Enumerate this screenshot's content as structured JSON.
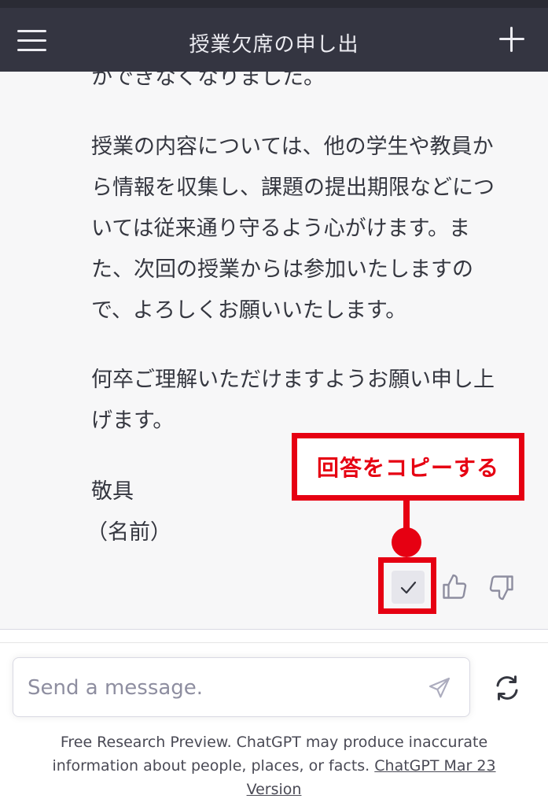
{
  "header": {
    "title": "授業欠席の申し出",
    "menu_icon": "hamburger-menu-icon",
    "new_chat_icon": "plus-icon"
  },
  "message": {
    "partial_line": "かできなくなりました。",
    "paragraphs": [
      [
        "授業の内容については、他の学生や教員か",
        "ら情報を収集し、課題の提出期限などにつ",
        "いては従来通り守るよう心がけます。ま",
        "た、次回の授業からは参加いたしますの",
        "で、よろしくお願いいたします。"
      ],
      [
        "何卒ご理解いただけますようお願い申し上",
        "げます。"
      ]
    ],
    "closing": "敬具",
    "signature": "（名前）"
  },
  "actions": {
    "copy_icon": "check-icon",
    "thumbs_up_icon": "thumbs-up-icon",
    "thumbs_down_icon": "thumbs-down-icon"
  },
  "annotation": {
    "label": "回答をコピーする",
    "color": "#e60012"
  },
  "composer": {
    "placeholder": "Send a message.",
    "send_icon": "paper-plane-icon",
    "regenerate_icon": "refresh-icon"
  },
  "footer": {
    "text": "Free Research Preview. ChatGPT may produce inaccurate information about people, places, or facts.",
    "link_text": "ChatGPT Mar 23 Version"
  },
  "colors": {
    "header_bg": "#343541",
    "message_bg": "#f7f7f8",
    "text": "#353740"
  }
}
